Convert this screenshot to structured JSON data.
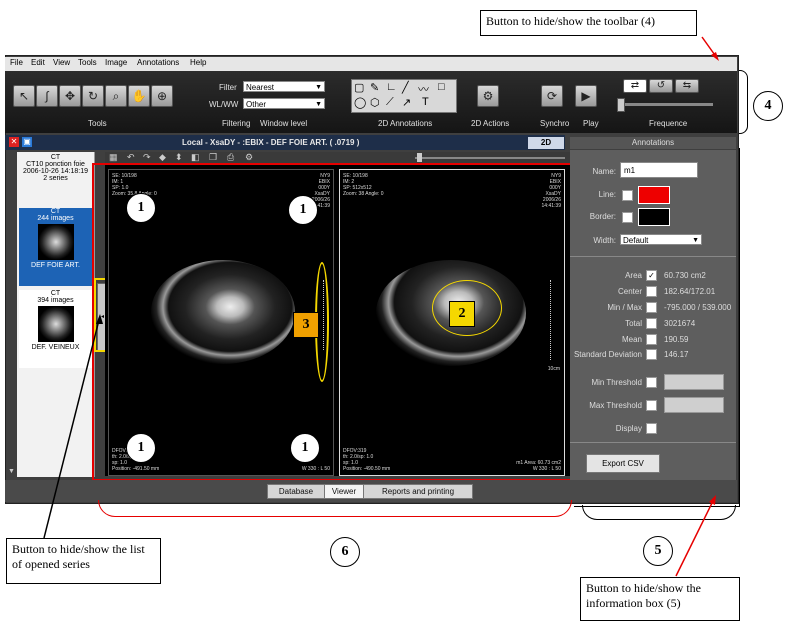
{
  "menu": [
    "File",
    "Edit",
    "View",
    "Tools",
    "Image",
    "Annotations",
    "Help"
  ],
  "toolbar": {
    "filter_label": "Filter",
    "filter_value": "Nearest",
    "wlww_label": "WL/WW",
    "wlww_value": "Other",
    "sections": [
      "Tools",
      "Filtering",
      "Window level",
      "2D Annotations",
      "2D Actions",
      "Synchro",
      "Play",
      "Frequence"
    ]
  },
  "header": {
    "title": "Local - XsaDY  -   :EBIX - DEF FOIE ART. ( .0719 )",
    "badge_2d": "2D",
    "annotations_tab": "Annotations"
  },
  "series_list": [
    {
      "modality": "CT",
      "name": "CT10 ponction foie",
      "date": "2006-10-26 14:18:19",
      "count": "2 series"
    },
    {
      "modality": "CT",
      "name": "244 images",
      "date": "",
      "count": "DEF FOIE ART."
    },
    {
      "modality": "CT",
      "name": "394 images",
      "date": "",
      "count": "DEF. VEINEUX"
    }
  ],
  "viewer_overlay": {
    "left_tl": "SE: 10/198\nIM: 1\nSP: 1.0\nZoom: 35.8 Angle: 0",
    "right_tl": "SE: 10/198\nIM: 2\nSP: 512x512\nZoom: 38 Angle: 0",
    "left_tr": "NY9\nEBIX\n000Y\nXsaDY\n2006/26\n14:41:39",
    "right_tr": "NY9\nEBIX\n000Y\nXsaDY\n2006/26\n14:41:39",
    "left_bl": "DFOV:319\nth: 2.0/sp: 1.0\nsp: 1.0\nPosition: -491.50 mm",
    "right_bl": "DFOV:319\nth: 2.0/sp: 1.0\nsp: 1.0\nPosition: -490.50 mm",
    "left_br": "W 330 : L 50",
    "right_br": "m1 Area: 60.73 cm2\nW 330 : L 50",
    "scale": "10cm"
  },
  "info": {
    "name_label": "Name:",
    "name_value": "m1",
    "line_label": "Line:",
    "border_label": "Border:",
    "width_label": "Width:",
    "width_value": "Default",
    "line_color": "#ee0000",
    "border_color": "#000000",
    "stats": [
      {
        "label": "Area",
        "value": "60.730 cm2"
      },
      {
        "label": "Center",
        "value": "182.64/172.01"
      },
      {
        "label": "Min / Max",
        "value": "-795.000 / 539.000"
      },
      {
        "label": "Total",
        "value": "3021674"
      },
      {
        "label": "Mean",
        "value": "190.59"
      },
      {
        "label": "Standard Deviation",
        "value": "146.17"
      }
    ],
    "min_threshold": "Min Threshold",
    "max_threshold": "Max Threshold",
    "display": "Display",
    "export": "Export CSV",
    "toggle": ">"
  },
  "bottom_tabs": [
    "Database",
    "Viewer",
    "Reports and printing"
  ],
  "callouts": {
    "toolbar": "Button to hide/show the toolbar (4)",
    "series": "Button to hide/show the list of opened series",
    "info": "Button to hide/show the information box (5)"
  },
  "numbers": {
    "n1": "1",
    "n2": "2",
    "n3": "3",
    "n4": "4",
    "n5": "5",
    "n6": "6"
  },
  "accent": {
    "red": "#e60000",
    "yellow": "#f5d800",
    "orange": "#f0a000",
    "blue": "#1c5fb0"
  }
}
